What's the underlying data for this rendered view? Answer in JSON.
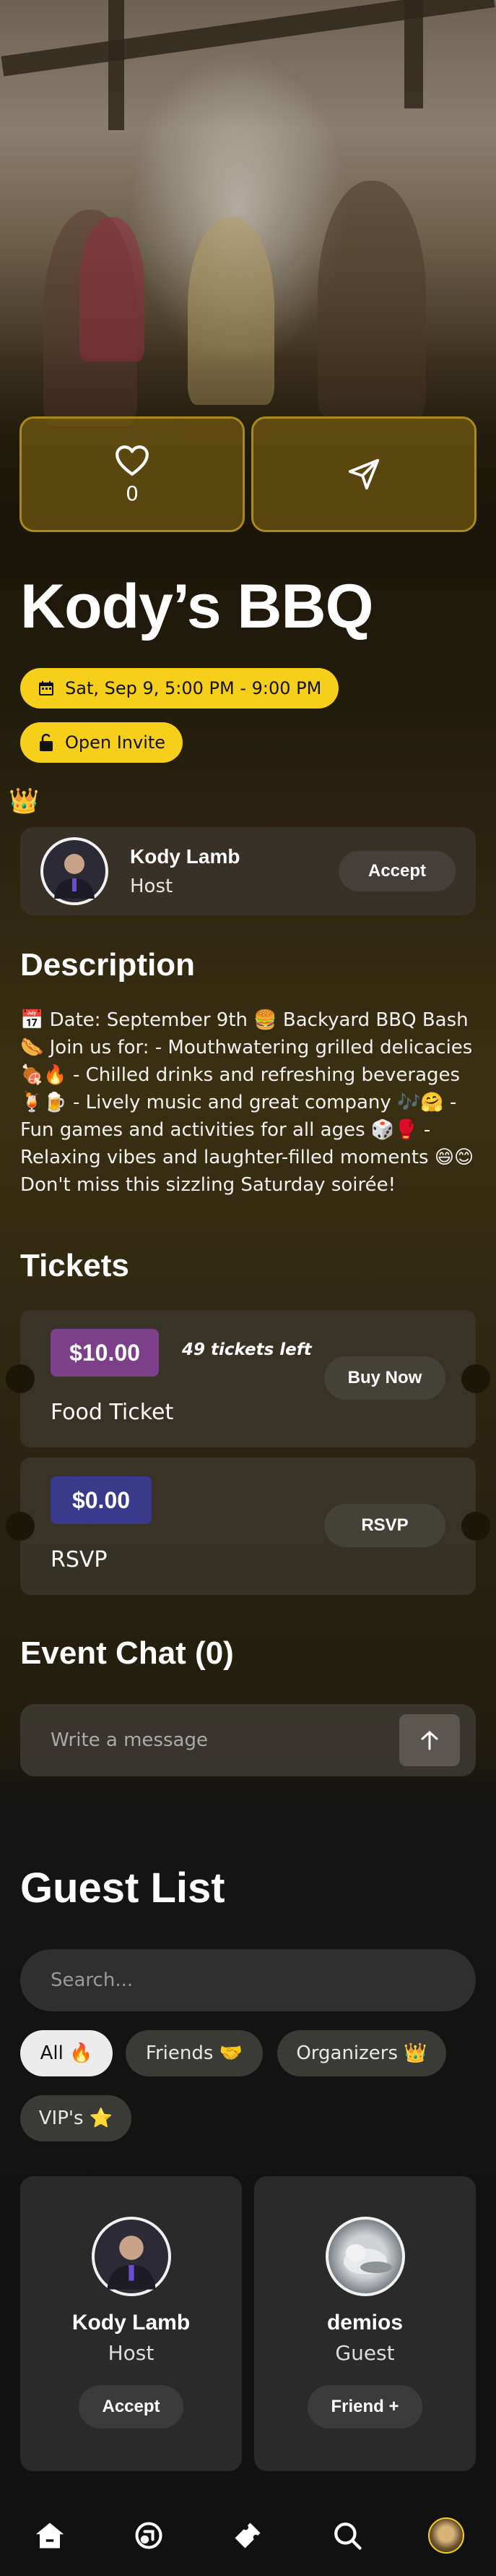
{
  "event": {
    "title": "Kody’s BBQ",
    "date_time": "Sat, Sep 9, 5:00 PM - 9:00 PM",
    "invite_type": "Open Invite",
    "like_count": "0"
  },
  "host_badge": "👑",
  "host": {
    "name": "Kody Lamb",
    "role": "Host",
    "action_label": "Accept"
  },
  "description": {
    "heading": "Description",
    "text": "📅 Date: September 9th 🍔 Backyard BBQ Bash 🌭 Join us for: - Mouthwatering grilled delicacies 🍖🔥 - Chilled drinks and refreshing beverages 🍹🍺 - Lively music and great company 🎶🤗 - Fun games and activities for all ages 🎲🥊 - Relaxing vibes and laughter-filled moments 😄😊 Don't miss this sizzling Saturday soirée!"
  },
  "tickets": {
    "heading": "Tickets",
    "items": [
      {
        "price": "$10.00",
        "price_color": "#7d3f8a",
        "remaining": "49 tickets left",
        "name": "Food Ticket",
        "action_label": "Buy Now"
      },
      {
        "price": "$0.00",
        "price_color": "#3a3a8c",
        "remaining": "",
        "name": "RSVP",
        "action_label": "RSVP"
      }
    ]
  },
  "chat": {
    "heading": "Event Chat (0)",
    "placeholder": "Write a message"
  },
  "guest_list": {
    "heading": "Guest List",
    "search_placeholder": "Search...",
    "filters": [
      {
        "label": "All 🔥",
        "active": true
      },
      {
        "label": "Friends 🤝",
        "active": false
      },
      {
        "label": "Organizers 👑",
        "active": false
      },
      {
        "label": "VIP's ⭐",
        "active": false
      }
    ],
    "guests": [
      {
        "name": "Kody Lamb",
        "role": "Host",
        "action_label": "Accept"
      },
      {
        "name": "demios",
        "role": "Guest",
        "action_label": "Friend +"
      }
    ]
  },
  "nav": {
    "items": [
      {
        "icon": "home-icon"
      },
      {
        "icon": "explore-icon"
      },
      {
        "icon": "ticket-icon"
      },
      {
        "icon": "search-icon"
      },
      {
        "icon": "profile-avatar"
      }
    ]
  },
  "colors": {
    "accent": "#f6cf1a",
    "action_card_border": "#a88a1c"
  }
}
